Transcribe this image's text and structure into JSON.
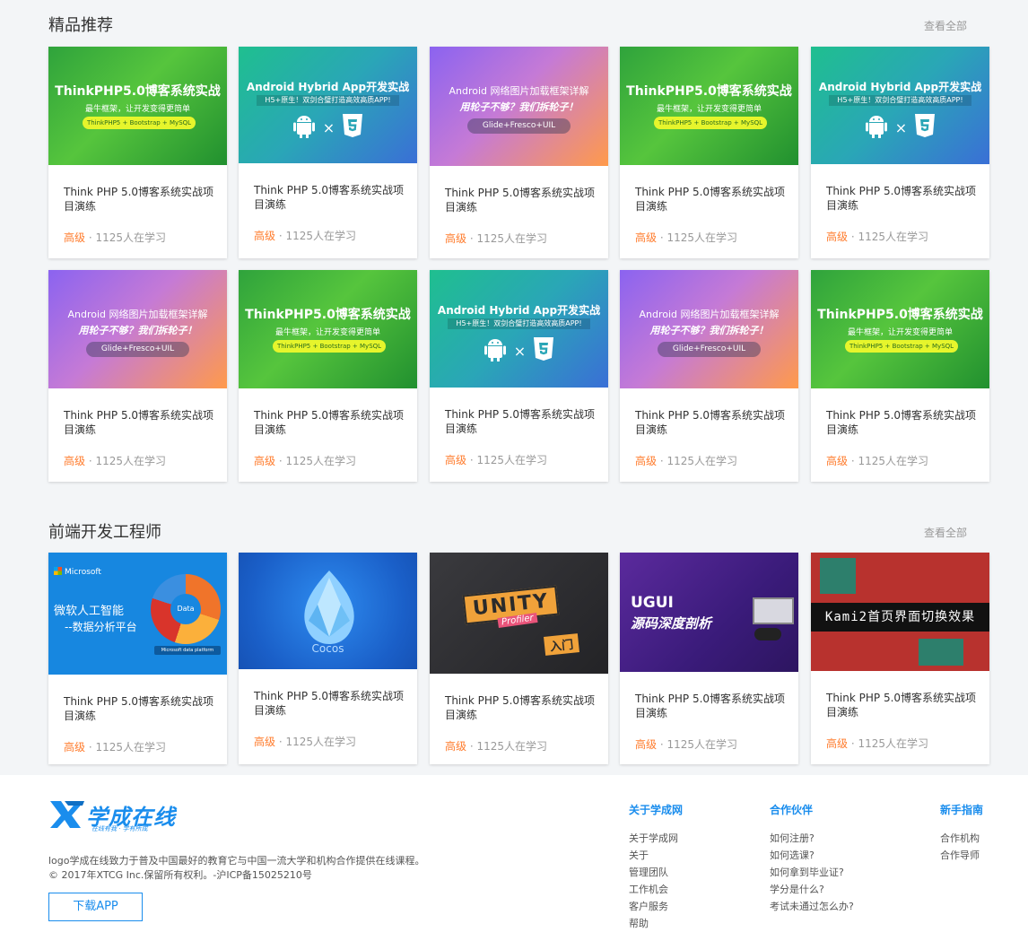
{
  "section1": {
    "title": "精品推荐",
    "view_all": "查看全部",
    "cards": [
      {
        "theme": "php",
        "title": "Think PHP 5.0博客系统实战项目演练",
        "level": "高级",
        "meta": " · 1125人在学习"
      },
      {
        "theme": "hybrid",
        "title": "Think PHP 5.0博客系统实战项目演练",
        "level": "高级",
        "meta": " · 1125人在学习"
      },
      {
        "theme": "glide",
        "title": "Think PHP 5.0博客系统实战项目演练",
        "level": "高级",
        "meta": " · 1125人在学习"
      },
      {
        "theme": "php",
        "title": "Think PHP 5.0博客系统实战项目演练",
        "level": "高级",
        "meta": " · 1125人在学习"
      },
      {
        "theme": "hybrid",
        "title": "Think PHP 5.0博客系统实战项目演练",
        "level": "高级",
        "meta": " · 1125人在学习"
      },
      {
        "theme": "glide",
        "title": "Think PHP 5.0博客系统实战项目演练",
        "level": "高级",
        "meta": " · 1125人在学习"
      },
      {
        "theme": "php",
        "title": "Think PHP 5.0博客系统实战项目演练",
        "level": "高级",
        "meta": " · 1125人在学习"
      },
      {
        "theme": "hybrid",
        "title": "Think PHP 5.0博客系统实战项目演练",
        "level": "高级",
        "meta": " · 1125人在学习"
      },
      {
        "theme": "glide",
        "title": "Think PHP 5.0博客系统实战项目演练",
        "level": "高级",
        "meta": " · 1125人在学习"
      },
      {
        "theme": "php",
        "title": "Think PHP 5.0博客系统实战项目演练",
        "level": "高级",
        "meta": " · 1125人在学习"
      }
    ]
  },
  "section2": {
    "title": "前端开发工程师",
    "view_all": "查看全部",
    "cards": [
      {
        "theme": "ms",
        "title": "Think PHP 5.0博客系统实战项目演练",
        "level": "高级",
        "meta": " · 1125人在学习"
      },
      {
        "theme": "cocos",
        "title": "Think PHP 5.0博客系统实战项目演练",
        "level": "高级",
        "meta": " · 1125人在学习"
      },
      {
        "theme": "unity",
        "title": "Think PHP 5.0博客系统实战项目演练",
        "level": "高级",
        "meta": " · 1125人在学习"
      },
      {
        "theme": "ugui",
        "title": "Think PHP 5.0博客系统实战项目演练",
        "level": "高级",
        "meta": " · 1125人在学习"
      },
      {
        "theme": "kami",
        "title": "Think PHP 5.0博客系统实战项目演练",
        "level": "高级",
        "meta": " · 1125人在学习"
      }
    ]
  },
  "thumbs": {
    "php": {
      "title": "ThinkPHP5.0博客系统实战",
      "sub": "最牛框架，让开发变得更简单",
      "pill": "ThinkPHP5 + Bootstrap + MySQL"
    },
    "hybrid": {
      "title": "Android Hybrid App开发实战",
      "sub": "H5+原生！双剑合璧打造高效高质APP!"
    },
    "glide": {
      "title": "Android 网络图片加载框架详解",
      "sub": "用轮子不够？我们拆轮子！",
      "pill": "Glide+Fresco+UIL"
    },
    "ms": {
      "brand": "Microsoft",
      "line1": "微软人工智能",
      "line2": "--数据分析平台",
      "ring": "Data",
      "platform": "Microsoft data platform"
    },
    "cocos": {
      "label": "Cocos"
    },
    "unity": {
      "word": "UNITY",
      "sub": "Profiler",
      "tag": "入门"
    },
    "ugui": {
      "line1": "UGUI",
      "line2": "源码深度剖析"
    },
    "kami": {
      "label": "Kami2首页界面切换效果"
    }
  },
  "footer": {
    "logo_text": "学成在线",
    "logo_slogan": "在线有我 · 学有所成",
    "desc_line1": "logo学成在线致力于普及中国最好的教育它与中国一流大学和机构合作提供在线课程。",
    "desc_line2": "© 2017年XTCG Inc.保留所有权利。-沪ICP备15025210号",
    "download_label": "下载APP",
    "columns": [
      {
        "title": "关于学成网",
        "links": [
          "关于学成网",
          "关于",
          "管理团队",
          "工作机会",
          "客户服务",
          "帮助"
        ]
      },
      {
        "title": "合作伙伴",
        "links": [
          "如何注册?",
          "如何选课?",
          "如何拿到毕业证?",
          "学分是什么?",
          "考试未通过怎么办?"
        ]
      },
      {
        "title": "新手指南",
        "links": [
          "合作机构",
          "合作导师"
        ]
      }
    ]
  }
}
